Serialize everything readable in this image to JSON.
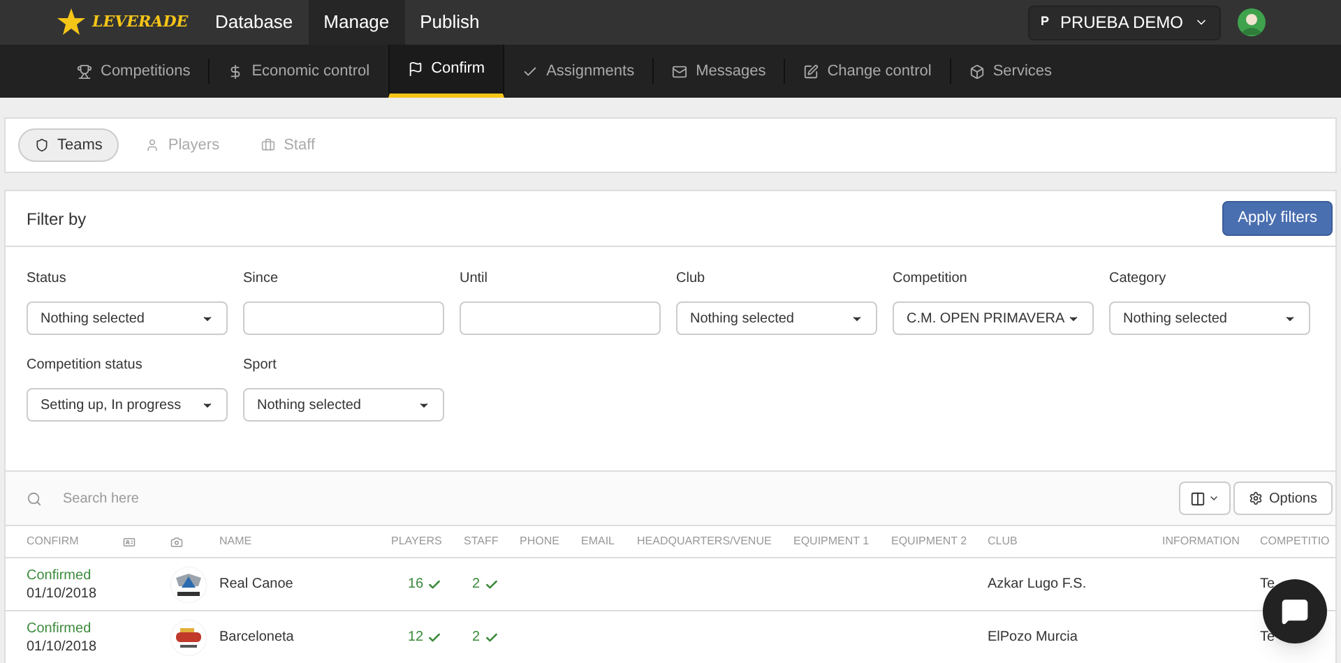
{
  "top_nav": {
    "logo": "LEVERADE",
    "items": [
      {
        "label": "Database",
        "selected": false
      },
      {
        "label": "Manage",
        "selected": true
      },
      {
        "label": "Publish",
        "selected": false
      }
    ],
    "account": {
      "initial": "P",
      "name": "PRUEBA DEMO"
    }
  },
  "sub_nav": [
    {
      "label": "Competitions",
      "selected": false
    },
    {
      "label": "Economic control",
      "selected": false
    },
    {
      "label": "Confirm",
      "selected": true
    },
    {
      "label": "Assignments",
      "selected": false
    },
    {
      "label": "Messages",
      "selected": false
    },
    {
      "label": "Change control",
      "selected": false
    },
    {
      "label": "Services",
      "selected": false
    }
  ],
  "type_tabs": [
    {
      "label": "Teams",
      "selected": true
    },
    {
      "label": "Players",
      "selected": false
    },
    {
      "label": "Staff",
      "selected": false
    }
  ],
  "filters": {
    "title": "Filter by",
    "apply_button": "Apply filters",
    "fields": [
      {
        "label": "Status",
        "kind": "select",
        "value": "Nothing selected"
      },
      {
        "label": "Since",
        "kind": "date"
      },
      {
        "label": "Until",
        "kind": "date"
      },
      {
        "label": "Club",
        "kind": "select",
        "value": "Nothing selected"
      },
      {
        "label": "Competition",
        "kind": "select",
        "value": "C.M. OPEN PRIMAVERA"
      },
      {
        "label": "Category",
        "kind": "select",
        "value": "Nothing selected"
      },
      {
        "label": "Competition status",
        "kind": "select",
        "value": "Setting up, In progress"
      },
      {
        "label": "Sport",
        "kind": "select",
        "value": "Nothing selected"
      }
    ]
  },
  "table": {
    "search_placeholder": "Search here",
    "options_button": "Options",
    "columns": [
      {
        "label": "CONFIRM",
        "kind": "text"
      },
      {
        "kind": "id-icon"
      },
      {
        "kind": "camera-icon"
      },
      {
        "label": "NAME",
        "kind": "text"
      },
      {
        "label": "PLAYERS",
        "kind": "text"
      },
      {
        "label": "STAFF",
        "kind": "text"
      },
      {
        "label": "PHONE",
        "kind": "text"
      },
      {
        "label": "EMAIL",
        "kind": "text"
      },
      {
        "label": "HEADQUARTERS/VENUE",
        "kind": "text"
      },
      {
        "label": "EQUIPMENT 1",
        "kind": "text"
      },
      {
        "label": "EQUIPMENT 2",
        "kind": "text"
      },
      {
        "label": "CLUB",
        "kind": "text"
      },
      {
        "label": "INFORMATION",
        "kind": "text"
      },
      {
        "label": "COMPETITIO",
        "kind": "text"
      }
    ],
    "rows": [
      {
        "status": "Confirmed",
        "date": "01/10/2018",
        "name": "Real Canoe",
        "players": "16",
        "staff": "2",
        "club": "Azkar Lugo F.S.",
        "competition": "Te"
      },
      {
        "status": "Confirmed",
        "date": "01/10/2018",
        "name": "Barceloneta",
        "players": "12",
        "staff": "2",
        "club": "ElPozo Murcia",
        "competition": "Te"
      }
    ]
  }
}
